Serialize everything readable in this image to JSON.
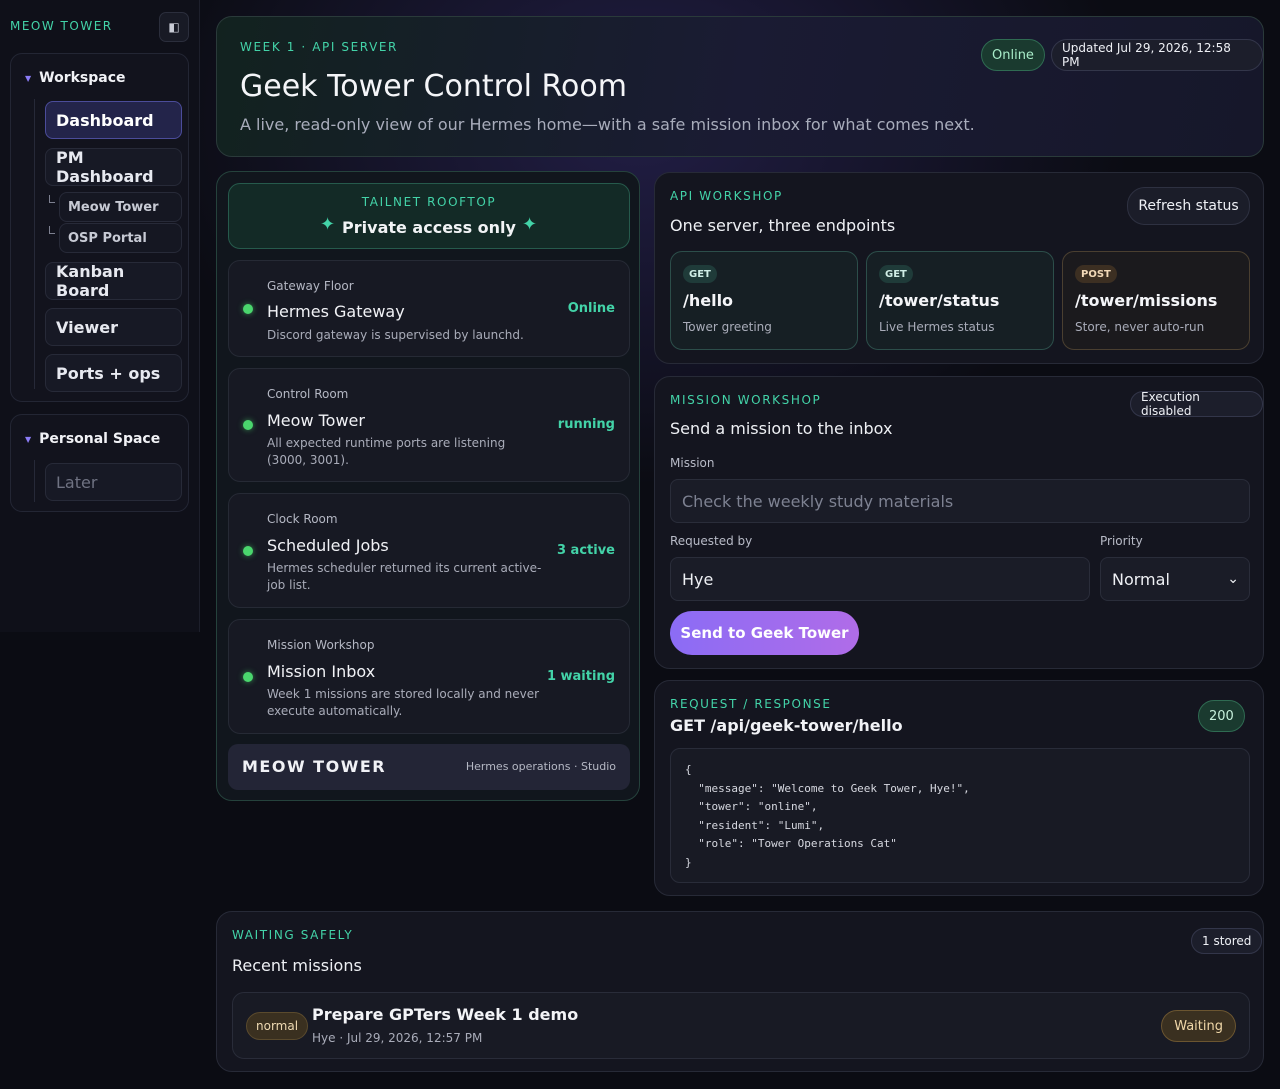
{
  "sidebar": {
    "brand": "MEOW TOWER",
    "collapse_icon": "◧",
    "workspace": {
      "title": "Workspace",
      "items": [
        {
          "label": "Dashboard",
          "active": true
        },
        {
          "label": "PM Dashboard"
        },
        {
          "label": "Meow Tower",
          "sub": true
        },
        {
          "label": "OSP Portal",
          "sub": true
        },
        {
          "label": "Kanban Board"
        },
        {
          "label": "Viewer"
        },
        {
          "label": "Ports + ops"
        }
      ]
    },
    "personal": {
      "title": "Personal Space",
      "items": [
        {
          "label": "Later"
        }
      ]
    }
  },
  "header": {
    "eyebrow": "WEEK 1 · API SERVER",
    "title": "Geek Tower Control Room",
    "subtitle": "A live, read-only view of our Hermes home—with a safe mission inbox for what comes next.",
    "status": "Online",
    "updated": "Updated Jul 29, 2026, 12:58 PM"
  },
  "rooftop": {
    "eyebrow": "TAILNET ROOFTOP",
    "title": "Private access only",
    "spark_glyph": "✦"
  },
  "services": [
    {
      "floor": "Gateway Floor",
      "name": "Hermes Gateway",
      "desc": "Discord gateway is supervised by launchd.",
      "state": "Online"
    },
    {
      "floor": "Control Room",
      "name": "Meow Tower",
      "desc": "All expected runtime ports are listening (3000, 3001).",
      "state": "running"
    },
    {
      "floor": "Clock Room",
      "name": "Scheduled Jobs",
      "desc": "Hermes scheduler returned its current active-job list.",
      "state": "3 active"
    },
    {
      "floor": "Mission Workshop",
      "name": "Mission Inbox",
      "desc": "Week 1 missions are stored locally and never execute automatically.",
      "state": "1 waiting"
    }
  ],
  "footer": {
    "logo": "MEOW TOWER",
    "meta": "Hermes operations · Studio"
  },
  "api": {
    "eyebrow": "API WORKSHOP",
    "subtitle": "One server, three endpoints",
    "refresh_label": "Refresh status",
    "endpoints": [
      {
        "method": "GET",
        "path": "/hello",
        "desc": "Tower greeting"
      },
      {
        "method": "GET",
        "path": "/tower/status",
        "desc": "Live Hermes status"
      },
      {
        "method": "POST",
        "path": "/tower/missions",
        "desc": "Store, never auto-run"
      }
    ]
  },
  "mission": {
    "eyebrow": "MISSION WORKSHOP",
    "subtitle": "Send a mission to the inbox",
    "badge": "Execution disabled",
    "mission_label": "Mission",
    "mission_placeholder": "Check the weekly study materials",
    "requested_label": "Requested by",
    "requested_value": "Hye",
    "priority_label": "Priority",
    "priority_value": "Normal",
    "chevron": "⌄",
    "send_label": "Send to Geek Tower"
  },
  "response": {
    "eyebrow": "REQUEST / RESPONSE",
    "request": "GET /api/geek-tower/hello",
    "status_code": "200",
    "body": "{\n  \"message\": \"Welcome to Geek Tower, Hye!\",\n  \"tower\": \"online\",\n  \"resident\": \"Lumi\",\n  \"role\": \"Tower Operations Cat\"\n}"
  },
  "recent": {
    "eyebrow": "WAITING SAFELY",
    "subtitle": "Recent missions",
    "count_badge": "1 stored",
    "missions": [
      {
        "priority": "normal",
        "title": "Prepare GPTers Week 1 demo",
        "meta": "Hye · Jul 29, 2026, 12:57 PM",
        "status": "Waiting"
      }
    ]
  },
  "colors": {
    "accent": "#43d3a8",
    "online_dot": "#4ad66d",
    "button_gradient_start": "#8b6cf5",
    "button_gradient_end": "#b06ce8",
    "warn": "#f0d7a8"
  }
}
